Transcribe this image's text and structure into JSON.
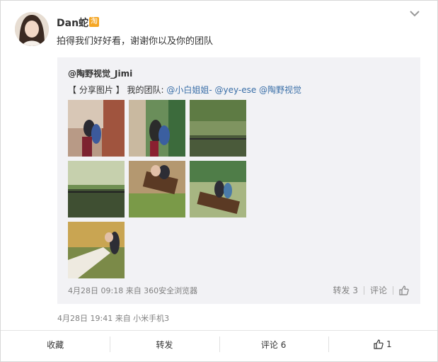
{
  "post": {
    "author": "Dan蛇",
    "badge": "淘",
    "text": "拍得我们好好看，谢谢你以及你的团队",
    "meta": "4月28日 19:41 来自 小米手机3"
  },
  "quoted": {
    "author": "@陶野视觉_Jimi",
    "text_prefix": "【 分享图片 】 我的团队: ",
    "mentions": [
      "@小白姐姐-",
      "@yey-ese",
      "@陶野视觉"
    ],
    "meta": "4月28日 09:18 来自 360安全浏览器",
    "repost_label": "转发 3",
    "comment_label": "评论"
  },
  "actions": {
    "favorite": "收藏",
    "repost": "转发",
    "comment": "评论 6",
    "like_count": "1"
  },
  "photo_count": 7
}
